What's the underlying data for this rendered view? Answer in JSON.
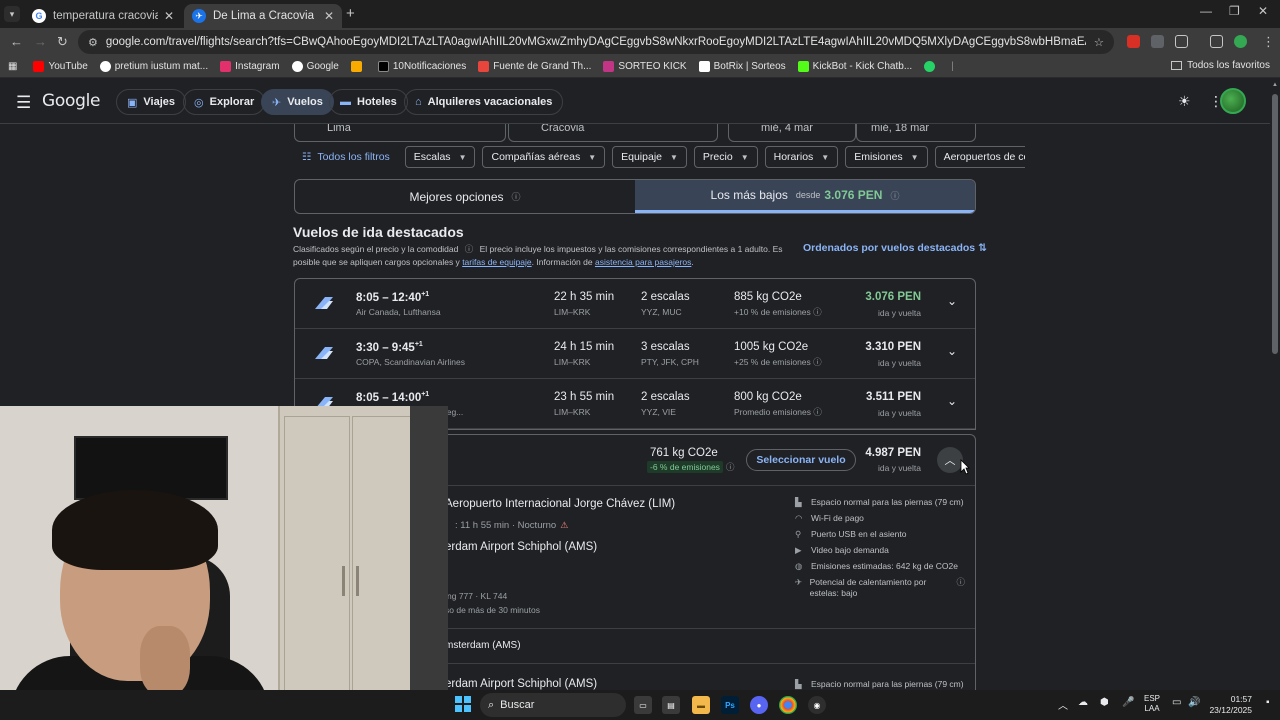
{
  "browser": {
    "tabs": [
      {
        "title": "temperatura cracovia - Buscar c",
        "active": false
      },
      {
        "title": "De Lima a Cracovia | Google Vu",
        "active": true
      }
    ],
    "url": "google.com/travel/flights/search?tfs=CBwQAhooEgoyMDI2LTAzLTA0agwIAhIIL20vMGxwZmhyDAgCEggvbS8wNkxrRooEgoyMDI2LTAzLTE4agwIAhIIL20vMDQ5MXlyDAgCEggvbS8wbHBmaEABSAFwAYIBCwj________8BmAEB&tfu=EgoIA...",
    "bookmarks": [
      "YouTube",
      "pretium iustum mat...",
      "Instagram",
      "Google",
      "",
      "10Notificaciones",
      "Fuente de Grand Th...",
      "SORTEO KICK",
      "BotRix | Sorteos",
      "KickBot - Kick Chatb...",
      ""
    ],
    "all_bookmarks": "Todos los favoritos"
  },
  "appbar": {
    "logo": "Google",
    "nav": [
      {
        "label": "Viajes",
        "icon": "suitcase-icon"
      },
      {
        "label": "Explorar",
        "icon": "explore-icon"
      },
      {
        "label": "Vuelos",
        "icon": "plane-icon",
        "active": true
      },
      {
        "label": "Hoteles",
        "icon": "bed-icon"
      },
      {
        "label": "Alquileres vacacionales",
        "icon": "house-icon"
      }
    ]
  },
  "search": {
    "origin": "Lima",
    "destination": "Cracovia",
    "depart": "mié, 4 mar",
    "return": "mié, 18 mar"
  },
  "filters": {
    "all": "Todos los filtros",
    "items": [
      "Escalas",
      "Compañías aéreas",
      "Equipaje",
      "Precio",
      "Horarios",
      "Emisiones",
      "Aeropuertos de cor"
    ]
  },
  "sort_tabs": {
    "best": "Mejores opciones",
    "cheapest": "Los más bajos",
    "from": "desde",
    "cheapest_price": "3.076 PEN"
  },
  "section": {
    "title": "Vuelos de ida destacados",
    "sub1": "Clasificados según el precio y la comodidad",
    "sub2": "El precio incluye los impuestos y las comisiones correspondientes a 1 adulto. Es posible que se apliquen cargos opcionales y",
    "link1": "tarifas de equipaje",
    "sub3": ". Información de",
    "link2": "asistencia para pasajeros",
    "sub4": ".",
    "sort_by": "Ordenados por vuelos destacados"
  },
  "flights": [
    {
      "times": "8:05 – 12:40",
      "plus": "+1",
      "airline": "Air Canada, Lufthansa",
      "duration": "22 h 35 min",
      "route": "LIM–KRK",
      "stops": "2 escalas",
      "via": "YYZ, MUC",
      "co2": "885 kg CO2e",
      "emissions": "+10 % de emisiones",
      "price": "3.076 PEN",
      "green": true,
      "trip": "ida y vuelta"
    },
    {
      "times": "3:30 – 9:45",
      "plus": "+1",
      "airline": "COPA, Scandinavian Airlines",
      "duration": "24 h 15 min",
      "route": "LIM–KRK",
      "stops": "3 escalas",
      "via": "PTY, JFK, CPH",
      "co2": "1005 kg CO2e",
      "emissions": "+25 % de emisiones",
      "price": "3.310 PEN",
      "green": false,
      "trip": "ida y vuelta"
    },
    {
      "times": "8:05 – 14:00",
      "plus": "+1",
      "airline": "perado por Braathens Reg...",
      "duration": "23 h 55 min",
      "route": "LIM–KRK",
      "stops": "2 escalas",
      "via": "YYZ, VIE",
      "co2": "800 kg CO2e",
      "emissions": "Promedio emisiones",
      "price": "3.511 PEN",
      "green": false,
      "trip": "ida y vuelta"
    }
  ],
  "expanded": {
    "co2": "761 kg CO2e",
    "emissions": "-6 % de emisiones",
    "select": "Seleccionar vuelo",
    "price": "4.987 PEN",
    "trip": "ida y vuelta",
    "airport_from": "Aeropuerto Internacional Jorge Chávez (LIM)",
    "travel_time": ": 11 h 55 min · Nocturno",
    "airport_to": "erdam Airport Schiphol (AMS)",
    "plane": "ng 777 · KL 744",
    "delay": "so de más de 30 minutos",
    "amenities": [
      {
        "icon": "legroom-icon",
        "text": "Espacio normal para las piernas (79 cm)"
      },
      {
        "icon": "wifi-icon",
        "text": "Wi-Fi de pago"
      },
      {
        "icon": "usb-icon",
        "text": "Puerto USB en el asiento"
      },
      {
        "icon": "video-icon",
        "text": "Video bajo demanda"
      },
      {
        "icon": "globe-icon",
        "text": "Emisiones estimadas: 642 kg de CO2e"
      },
      {
        "icon": "contrail-icon",
        "text": "Potencial de calentamiento por estelas: bajo"
      }
    ],
    "layover": "msterdam (AMS)",
    "airport2": "erdam Airport Schiphol (AMS)",
    "amenity2": "Espacio normal para las piernas (79 cm)"
  },
  "taskbar": {
    "search": "Buscar",
    "lang1": "ESP",
    "lang2": "LAA",
    "time": "01:57",
    "date": "23/12/2025"
  },
  "colors": {
    "bg": "#202124",
    "accent": "#8ab4f8",
    "green": "#81c995"
  }
}
